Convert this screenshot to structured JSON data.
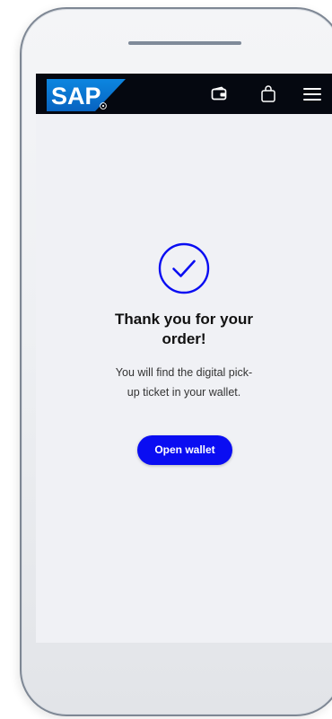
{
  "shell": {
    "logo_text": "SAP",
    "icons": {
      "wallet": "wallet-icon",
      "bag": "shopping-bag-icon",
      "menu": "menu-icon"
    }
  },
  "confirmation": {
    "icon": "check-circle-icon",
    "title": "Thank you for your\norder!",
    "message": "You will find the digital pick-\nup ticket in your wallet.",
    "button_label": "Open wallet"
  },
  "colors": {
    "shell_bar": "#050810",
    "accent": "#0a0df2",
    "sap_blue": "#0a77d4",
    "screen_bg": "#f0f1f5"
  }
}
